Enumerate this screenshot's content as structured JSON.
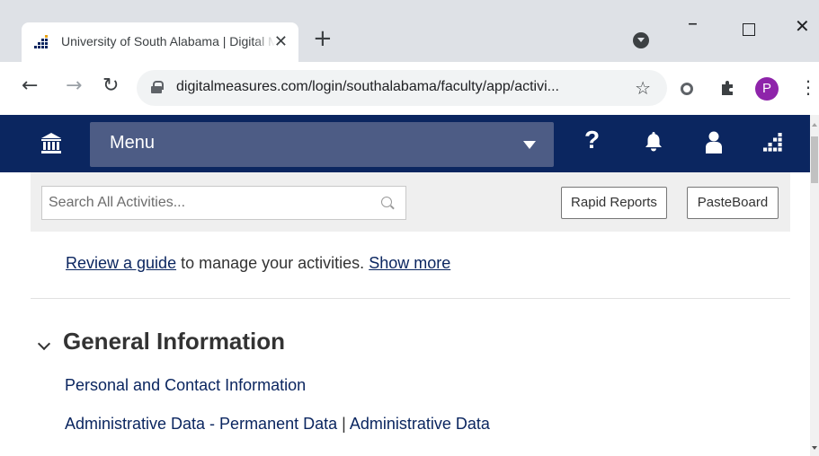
{
  "browser": {
    "tab_title": "University of South Alabama | Digital Measures",
    "url": "digitalmeasures.com/login/southalabama/faculty/app/activi...",
    "profile_initial": "P"
  },
  "header": {
    "menu_label": "Menu",
    "help_label": "?"
  },
  "search": {
    "placeholder": "Search All Activities..."
  },
  "toolbar": {
    "rapid_reports_label": "Rapid Reports",
    "pasteboard_label": "PasteBoard"
  },
  "guide": {
    "link_text": "Review a guide",
    "middle_text": " to manage your activities. ",
    "show_more_text": "Show more"
  },
  "section": {
    "title": "General Information",
    "items": [
      {
        "label": "Personal and Contact Information"
      },
      {
        "label_a": "Administrative Data - Permanent Data",
        "sep": " | ",
        "label_b": "Administrative Data"
      }
    ]
  },
  "colors": {
    "header_navy": "#0b2660",
    "menu_bar": "#4d5c85",
    "profile_purple": "#8e24aa"
  }
}
